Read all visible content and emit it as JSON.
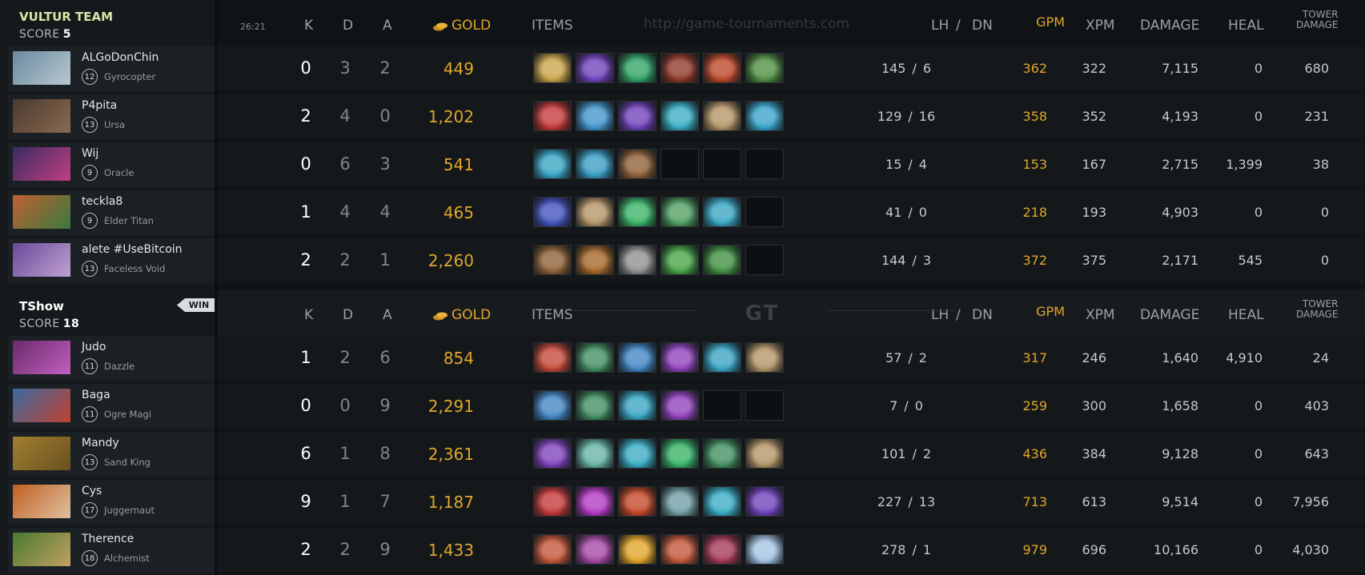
{
  "timer": "26:21",
  "watermark": "http://game-tournaments.com",
  "logo_text": "GT",
  "columns": {
    "k": "K",
    "d": "D",
    "a": "A",
    "gold": "GOLD",
    "items": "ITEMS",
    "lh": "LH",
    "slash": "/",
    "dn": "DN",
    "gpm": "GPM",
    "xpm": "XPM",
    "damage": "DAMAGE",
    "heal": "HEAL",
    "tower_damage_1": "TOWER",
    "tower_damage_2": "DAMAGE"
  },
  "colors": {
    "gold": "#e0a62a",
    "team1_name": "#d9e6a6",
    "team2_name": "#ffffff"
  },
  "teams": [
    {
      "name": "VULTUR TEAM",
      "score_label": "SCORE",
      "score": "5",
      "win": false,
      "players": [
        {
          "name": "ALGoDonChin",
          "level": "12",
          "hero": "Gyrocopter",
          "k": "0",
          "d": "3",
          "a": "2",
          "gold": "449",
          "lh": "145",
          "dn": "6",
          "gpm": "362",
          "xpm": "322",
          "damage": "7,115",
          "heal": "0",
          "tower_damage": "680",
          "avatar": [
            "#6a8aa0",
            "#b8c8d0"
          ],
          "items": [
            "#c8a040",
            "#6a3ab8",
            "#2aa060",
            "#8a3020",
            "#b84020",
            "#4a8a3a"
          ]
        },
        {
          "name": "P4pita",
          "level": "13",
          "hero": "Ursa",
          "k": "2",
          "d": "4",
          "a": "0",
          "gold": "1,202",
          "lh": "129",
          "dn": "16",
          "gpm": "358",
          "xpm": "352",
          "damage": "4,193",
          "heal": "0",
          "tower_damage": "231",
          "avatar": [
            "#4a3a30",
            "#8a6a50"
          ],
          "items": [
            "#c03030",
            "#3a90c8",
            "#6a3ab8",
            "#30a8c0",
            "#b09060",
            "#30a0c8"
          ]
        },
        {
          "name": "Wij",
          "level": "9",
          "hero": "Oracle",
          "k": "0",
          "d": "6",
          "a": "3",
          "gold": "541",
          "lh": "15",
          "dn": "4",
          "gpm": "153",
          "xpm": "167",
          "damage": "2,715",
          "heal": "1,399",
          "tower_damage": "38",
          "avatar": [
            "#3a2a60",
            "#c04080"
          ],
          "items": [
            "#30a0c0",
            "#3098c0",
            "#8a5a30",
            null,
            null,
            null
          ]
        },
        {
          "name": "teckla8",
          "level": "9",
          "hero": "Elder Titan",
          "k": "1",
          "d": "4",
          "a": "4",
          "gold": "465",
          "lh": "41",
          "dn": "0",
          "gpm": "218",
          "xpm": "193",
          "damage": "4,903",
          "heal": "0",
          "tower_damage": "0",
          "avatar": [
            "#c06030",
            "#3a7a40"
          ],
          "items": [
            "#3a4ab8",
            "#b09060",
            "#30b060",
            "#4a9a5a",
            "#30a0c0",
            null
          ]
        },
        {
          "name": "alete #UseBitcoin",
          "level": "13",
          "hero": "Faceless Void",
          "k": "2",
          "d": "2",
          "a": "1",
          "gold": "2,260",
          "lh": "144",
          "dn": "3",
          "gpm": "372",
          "xpm": "375",
          "damage": "2,171",
          "heal": "545",
          "tower_damage": "0",
          "avatar": [
            "#6a4a9a",
            "#c0a0d0"
          ],
          "items": [
            "#8a5a30",
            "#a06020",
            "#8a8a8a",
            "#40a040",
            "#3a8a3a",
            null
          ]
        }
      ]
    },
    {
      "name": "TShow",
      "score_label": "SCORE",
      "score": "18",
      "win": true,
      "win_label": "WIN",
      "players": [
        {
          "name": "Judo",
          "level": "11",
          "hero": "Dazzle",
          "k": "1",
          "d": "2",
          "a": "6",
          "gold": "854",
          "lh": "57",
          "dn": "2",
          "gpm": "317",
          "xpm": "246",
          "damage": "1,640",
          "heal": "4,910",
          "tower_damage": "24",
          "avatar": [
            "#6a2a6a",
            "#c060c0"
          ],
          "items": [
            "#c04030",
            "#3a8a5a",
            "#3a80c0",
            "#8a3ab8",
            "#30a0c0",
            "#b09060"
          ]
        },
        {
          "name": "Baga",
          "level": "11",
          "hero": "Ogre Magi",
          "k": "0",
          "d": "0",
          "a": "9",
          "gold": "2,291",
          "lh": "7",
          "dn": "0",
          "gpm": "259",
          "xpm": "300",
          "damage": "1,658",
          "heal": "0",
          "tower_damage": "403",
          "avatar": [
            "#3a6aa0",
            "#c04030"
          ],
          "items": [
            "#3a80c0",
            "#3a8a5a",
            "#30a0c0",
            "#8a3ab8",
            null,
            null
          ]
        },
        {
          "name": "Mandy",
          "level": "13",
          "hero": "Sand King",
          "k": "6",
          "d": "1",
          "a": "8",
          "gold": "2,361",
          "lh": "101",
          "dn": "2",
          "gpm": "436",
          "xpm": "384",
          "damage": "9,128",
          "heal": "0",
          "tower_damage": "643",
          "avatar": [
            "#a08030",
            "#6a5020"
          ],
          "items": [
            "#7a3ab8",
            "#60b0a0",
            "#30a8c0",
            "#30b060",
            "#3a8a5a",
            "#b09060"
          ]
        },
        {
          "name": "Cys",
          "level": "17",
          "hero": "Juggernaut",
          "k": "9",
          "d": "1",
          "a": "7",
          "gold": "1,187",
          "lh": "227",
          "dn": "13",
          "gpm": "713",
          "xpm": "613",
          "damage": "9,514",
          "heal": "0",
          "tower_damage": "7,956",
          "avatar": [
            "#c06020",
            "#e0c0a0"
          ],
          "items": [
            "#c03030",
            "#b030c0",
            "#c04020",
            "#6a9aa0",
            "#30a8c0",
            "#6a3ab8"
          ]
        },
        {
          "name": "Therence",
          "level": "18",
          "hero": "Alchemist",
          "k": "2",
          "d": "2",
          "a": "9",
          "gold": "1,433",
          "lh": "278",
          "dn": "1",
          "gpm": "979",
          "xpm": "696",
          "damage": "10,166",
          "heal": "0",
          "tower_damage": "4,030",
          "avatar": [
            "#4a7a30",
            "#c0a060"
          ],
          "items": [
            "#c05030",
            "#a040a0",
            "#e0a020",
            "#c05030",
            "#a03050",
            "#a0c0e0"
          ]
        }
      ]
    }
  ]
}
